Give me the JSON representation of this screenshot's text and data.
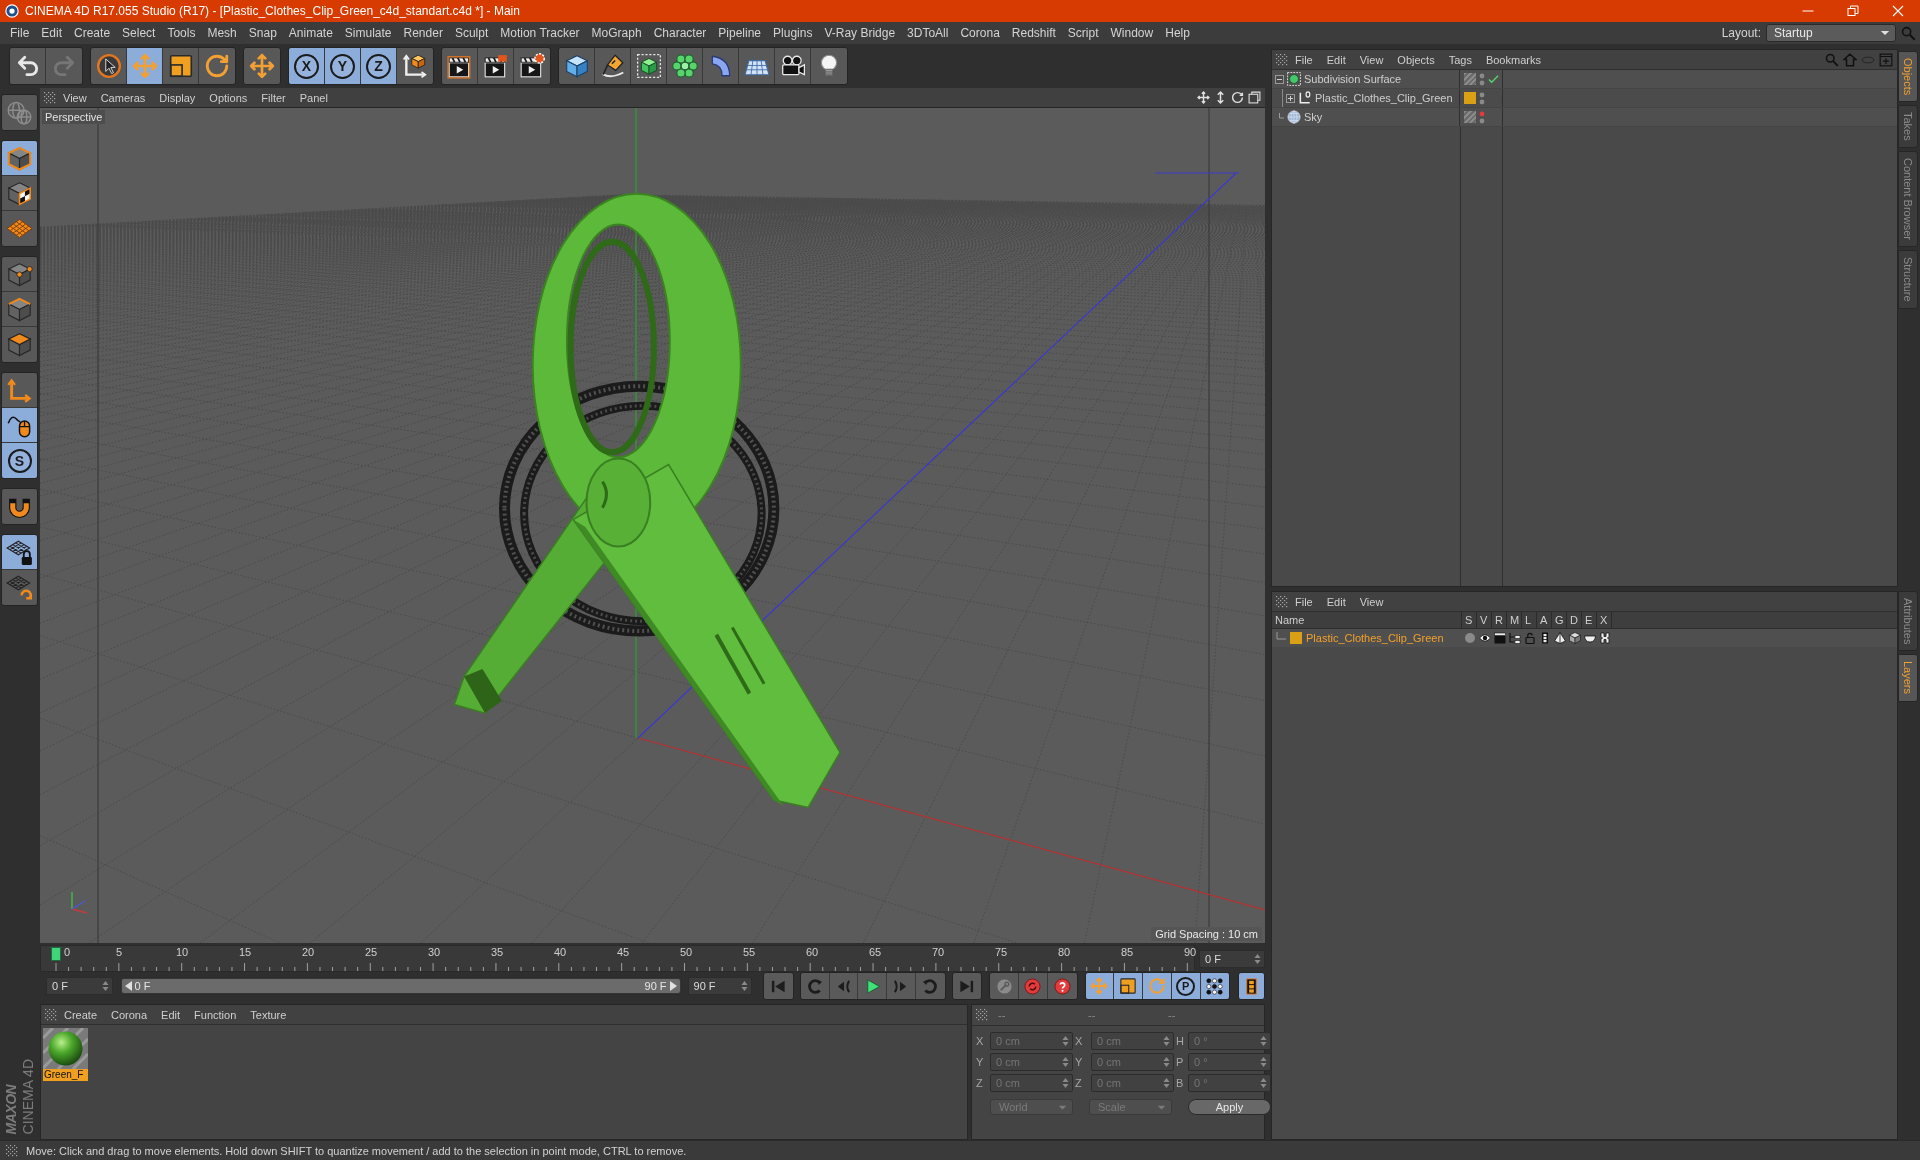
{
  "window": {
    "title": "CINEMA 4D R17.055 Studio (R17) - [Plastic_Clothes_Clip_Green_c4d_standart.c4d *] - Main"
  },
  "menu_bar": [
    "File",
    "Edit",
    "Create",
    "Select",
    "Tools",
    "Mesh",
    "Snap",
    "Animate",
    "Simulate",
    "Render",
    "Sculpt",
    "Motion Tracker",
    "MoGraph",
    "Character",
    "Pipeline",
    "Plugins",
    "V-Ray Bridge",
    "3DToAll",
    "Corona",
    "Redshift",
    "Script",
    "Window",
    "Help"
  ],
  "layout": {
    "label": "Layout:",
    "value": "Startup"
  },
  "toolbar": [
    {
      "items": [
        {
          "kind": "undo",
          "disabled": false
        },
        {
          "kind": "redo",
          "disabled": true
        }
      ]
    },
    {
      "items": [
        {
          "kind": "select",
          "selected": false
        },
        {
          "kind": "move",
          "selected": true
        },
        {
          "kind": "scale",
          "selected": false
        },
        {
          "kind": "rotate",
          "selected": false
        }
      ]
    },
    {
      "items": [
        {
          "kind": "recent",
          "selected": false
        }
      ]
    },
    {
      "items": [
        {
          "kind": "axis",
          "label": "X",
          "selected": true
        },
        {
          "kind": "axis",
          "label": "Y",
          "selected": true
        },
        {
          "kind": "axis",
          "label": "Z",
          "selected": true
        },
        {
          "kind": "coords",
          "selected": false
        }
      ]
    },
    {
      "items": [
        {
          "kind": "renderview"
        },
        {
          "kind": "render"
        },
        {
          "kind": "rendersettings"
        }
      ]
    },
    {
      "items": [
        {
          "kind": "cube"
        },
        {
          "kind": "pen"
        },
        {
          "kind": "subdivision"
        },
        {
          "kind": "cloner"
        },
        {
          "kind": "deformer"
        },
        {
          "kind": "floor"
        },
        {
          "kind": "camera"
        },
        {
          "kind": "light"
        }
      ]
    }
  ],
  "mode_toolbar": [
    {
      "items": [
        {
          "kind": "editable",
          "disabled": true
        }
      ]
    },
    {
      "items": [
        {
          "kind": "model",
          "selected": true
        },
        {
          "kind": "texture",
          "selected": false
        },
        {
          "kind": "workplane",
          "selected": false
        }
      ]
    },
    {
      "items": [
        {
          "kind": "points",
          "selected": false
        },
        {
          "kind": "edges",
          "selected": false
        },
        {
          "kind": "polygons",
          "selected": false
        }
      ]
    },
    {
      "items": [
        {
          "kind": "axis",
          "selected": false
        },
        {
          "kind": "tweak",
          "selected": true
        },
        {
          "kind": "snap",
          "label": "S",
          "selected": true
        }
      ]
    },
    {
      "items": [
        {
          "kind": "magnet",
          "selected": false
        }
      ]
    },
    {
      "items": [
        {
          "kind": "gridlock",
          "selected": true
        },
        {
          "kind": "gridrotate",
          "selected": false
        }
      ]
    }
  ],
  "logo": {
    "brand": "MAXON",
    "product": "CINEMA 4D"
  },
  "viewport": {
    "menu": [
      "View",
      "Cameras",
      "Display",
      "Options",
      "Filter",
      "Panel"
    ],
    "camera": "Perspective",
    "grid_spacing": "Grid Spacing : 10 cm"
  },
  "timeline": {
    "ticks": [
      "0",
      "5",
      "10",
      "15",
      "20",
      "25",
      "30",
      "35",
      "40",
      "45",
      "50",
      "55",
      "60",
      "65",
      "70",
      "75",
      "80",
      "85",
      "90"
    ],
    "playhead": {
      "level": 0
    },
    "frame_field": "0 F",
    "start_field": "0 F",
    "range": {
      "start": "0 F",
      "end": "90 F",
      "level": 1
    },
    "end_field": "90 F",
    "transport": [
      {
        "items": [
          {
            "kind": "first"
          }
        ]
      },
      {
        "items": [
          {
            "kind": "prevkey"
          },
          {
            "kind": "prevframe"
          },
          {
            "kind": "play"
          },
          {
            "kind": "nextframe"
          },
          {
            "kind": "nextkey"
          }
        ]
      },
      {
        "items": [
          {
            "kind": "last"
          }
        ]
      }
    ],
    "keys": [
      {
        "kind": "keyrecord"
      },
      {
        "kind": "autokey"
      },
      {
        "kind": "keyselection"
      }
    ],
    "key_filters": [
      {
        "kind": "move",
        "selected": true
      },
      {
        "kind": "scale",
        "selected": true
      },
      {
        "kind": "rotate",
        "selected": true
      },
      {
        "kind": "param",
        "label": "P",
        "selected": true
      },
      {
        "kind": "points",
        "selected": true
      }
    ],
    "timeline_button": {
      "selected": true
    }
  },
  "materials": {
    "menu": [
      "Create",
      "Corona",
      "Edit",
      "Function",
      "Texture"
    ],
    "items": [
      {
        "name": "Green_F",
        "selected": true
      }
    ]
  },
  "coordinates": {
    "headers": [
      "--",
      "--",
      "--"
    ],
    "rows": [
      {
        "position_axis": "X",
        "position": "0 cm",
        "size_axis": "X",
        "size": "0 cm",
        "rotation_axis": "H",
        "rotation": "0 °"
      },
      {
        "position_axis": "Y",
        "position": "0 cm",
        "size_axis": "Y",
        "size": "0 cm",
        "rotation_axis": "P",
        "rotation": "0 °"
      },
      {
        "position_axis": "Z",
        "position": "0 cm",
        "size_axis": "Z",
        "size": "0 cm",
        "rotation_axis": "B",
        "rotation": "0 °"
      }
    ],
    "modes": [
      "World",
      "Scale"
    ],
    "apply": "Apply"
  },
  "objects": {
    "menu": [
      "File",
      "Edit",
      "View",
      "Objects",
      "Tags",
      "Bookmarks"
    ],
    "tree": [
      {
        "name": "Subdivision Surface",
        "kind": "subdivision",
        "selected": false,
        "expanded": true,
        "hidden_in_editor": false,
        "enabled": true,
        "children": [
          {
            "name": "Plastic_Clothes_Clip_Green",
            "kind": "null",
            "selected": false,
            "expanded": false,
            "hidden_in_editor": false,
            "color": "#d9a016"
          }
        ]
      },
      {
        "name": "Sky",
        "kind": "sky",
        "selected": false,
        "hidden_in_editor": true
      }
    ]
  },
  "layers": {
    "menu": [
      "File",
      "Edit",
      "View"
    ],
    "columns": [
      "Name",
      "S",
      "V",
      "R",
      "M",
      "L",
      "A",
      "G",
      "D",
      "E",
      "X"
    ],
    "items": [
      {
        "name": "Plastic_Clothes_Clip_Green",
        "color": "#d9a016",
        "selected": true
      }
    ]
  },
  "side_tabs": {
    "top": [
      {
        "label": "Objects",
        "selected": true
      },
      {
        "label": "Takes",
        "selected": false
      },
      {
        "label": "Content Browser",
        "selected": false
      },
      {
        "label": "Structure",
        "selected": false
      }
    ],
    "bottom": [
      {
        "label": "Attributes",
        "selected": false
      },
      {
        "label": "Layers",
        "selected": true
      }
    ]
  },
  "status_bar": "Move: Click and drag to move elements. Hold down SHIFT to quantize movement / add to the selection in point mode, CTRL to remove."
}
